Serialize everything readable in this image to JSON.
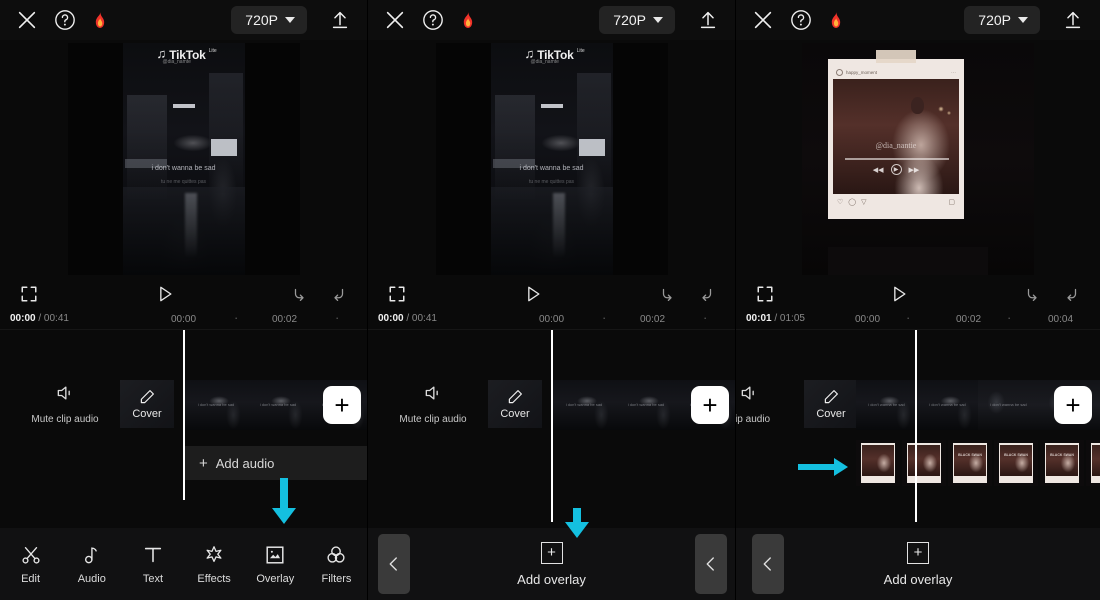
{
  "header": {
    "close_icon": "close-icon",
    "help_icon": "help-circle-icon",
    "flame_icon": "flame-icon",
    "resolution": "720P",
    "export_icon": "export-upload-icon"
  },
  "preview": {
    "tiktok_watermark": "TikTok",
    "tiktok_sup": "Lite",
    "tiktok_user": "@dia_namte",
    "caption": "i don't wanna be sad",
    "caption_small": "tu ne me quittes pas",
    "instagram": {
      "username": "happy_moment",
      "handle": "@dia_nantie",
      "more_icon": "more-dots-icon",
      "like_icon": "heart-icon",
      "comment_icon": "comment-icon",
      "share_icon": "share-icon",
      "save_icon": "bookmark-icon",
      "prev_icon": "previous-icon",
      "play_icon": "play-icon",
      "next_icon": "next-icon",
      "note_icon": "music-note-icon"
    }
  },
  "transport": {
    "fullscreen_icon": "fullscreen-expand-icon",
    "play_icon": "play-icon",
    "undo_icon": "undo-icon",
    "redo_icon": "redo-icon"
  },
  "panels": [
    {
      "id": "panel-1",
      "timeline": {
        "current_time": "00:00",
        "separator": "/",
        "total_time": "00:41",
        "ticks": [
          "00:00",
          "·",
          "00:02",
          "·"
        ],
        "mute_label": "Mute clip audio",
        "mute_icon": "speaker-mute-icon",
        "cover_label": "Cover",
        "cover_icon": "pencil-edit-icon",
        "add_clip_icon": "plus-icon",
        "add_audio_label": "Add audio",
        "add_audio_icon": "plus-icon"
      },
      "toolbar": {
        "items": [
          {
            "label": "Edit",
            "icon": "scissors-icon"
          },
          {
            "label": "Audio",
            "icon": "music-note-icon"
          },
          {
            "label": "Text",
            "icon": "text-t-icon"
          },
          {
            "label": "Effects",
            "icon": "sparkle-star-icon"
          },
          {
            "label": "Overlay",
            "icon": "overlay-picture-icon"
          },
          {
            "label": "Filters",
            "icon": "filters-circles-icon"
          }
        ],
        "highlight_arrow_target": "Overlay"
      }
    },
    {
      "id": "panel-2",
      "timeline": {
        "current_time": "00:00",
        "separator": "/",
        "total_time": "00:41",
        "ticks": [
          "00:00",
          "·",
          "00:02",
          "·"
        ],
        "mute_label": "Mute clip audio",
        "mute_icon": "speaker-mute-icon",
        "cover_label": "Cover",
        "cover_icon": "pencil-edit-icon",
        "add_clip_icon": "plus-icon"
      },
      "toolbar": {
        "back_icon": "chevron-left-icon",
        "add_overlay_label": "Add overlay",
        "add_overlay_icon": "plus-box-icon",
        "highlight_arrow_target": "Add overlay"
      }
    },
    {
      "id": "panel-3",
      "timeline": {
        "current_time": "00:01",
        "separator": "/",
        "total_time": "01:05",
        "ticks": [
          "00:00",
          "·",
          "00:02",
          "·",
          "00:04"
        ],
        "mute_label": "clip audio",
        "mute_icon": "speaker-mute-icon",
        "cover_label": "Cover",
        "cover_icon": "pencil-edit-icon",
        "add_clip_icon": "plus-icon",
        "overlay_thumb_text": "BLACK SWAN",
        "overlay_arrow": "arrow-right-pointer"
      },
      "toolbar": {
        "back_icon": "chevron-left-icon",
        "add_overlay_label": "Add overlay",
        "add_overlay_icon": "plus-box-icon"
      }
    }
  ],
  "colors": {
    "accent_arrow": "#14c0e0",
    "flame": "#f0322a",
    "background": "#0a0a0a",
    "toolbar_bg": "#111112",
    "playhead": "#ffffff"
  }
}
